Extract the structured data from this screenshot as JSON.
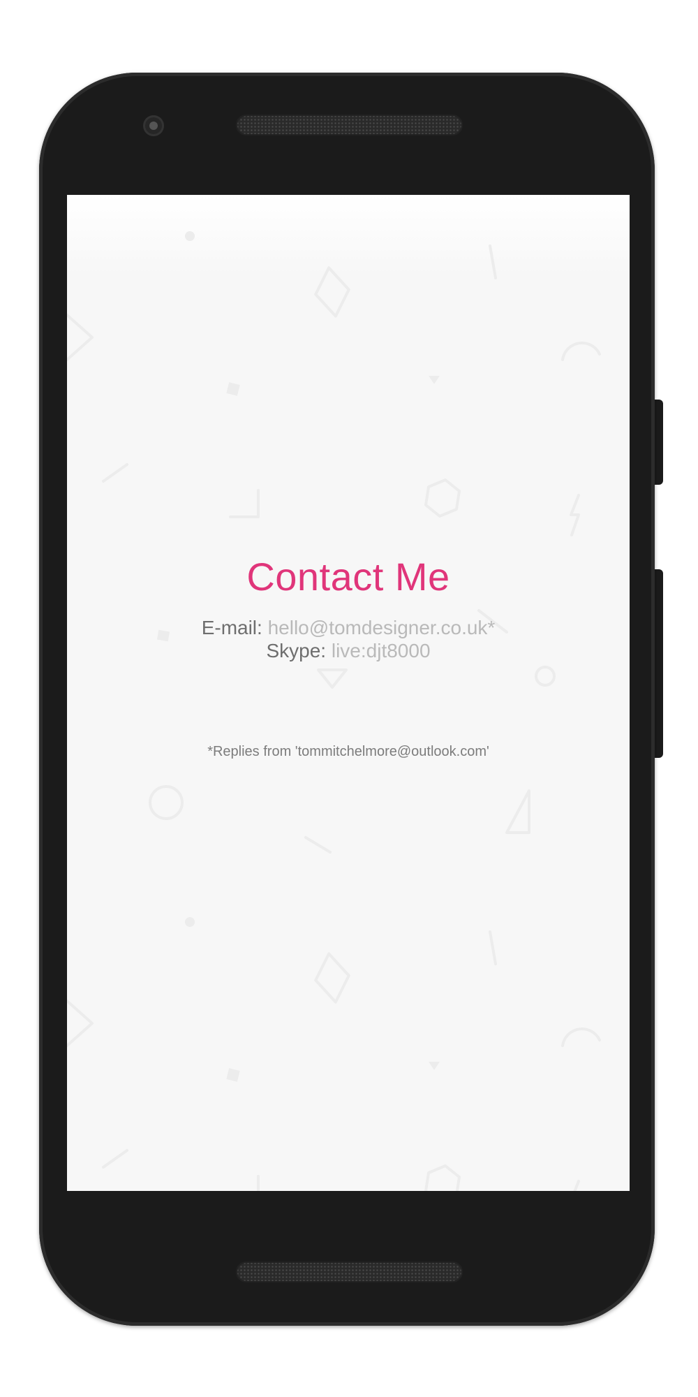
{
  "contact": {
    "title": "Contact Me",
    "email_label": "E-mail:",
    "email_value": "hello@tomdesigner.co.uk*",
    "skype_label": "Skype:",
    "skype_value": "live:djt8000",
    "reply_note": "*Replies from 'tommitchelmore@outlook.com'"
  },
  "colors": {
    "accent": "#e0357a",
    "phone_body": "#1b1b1b",
    "screen_background": "#f7f7f7",
    "label_text": "#6e6e6e",
    "value_text": "#b9b9b9"
  },
  "icons": [
    "camera-icon",
    "speaker-grille-icon"
  ]
}
